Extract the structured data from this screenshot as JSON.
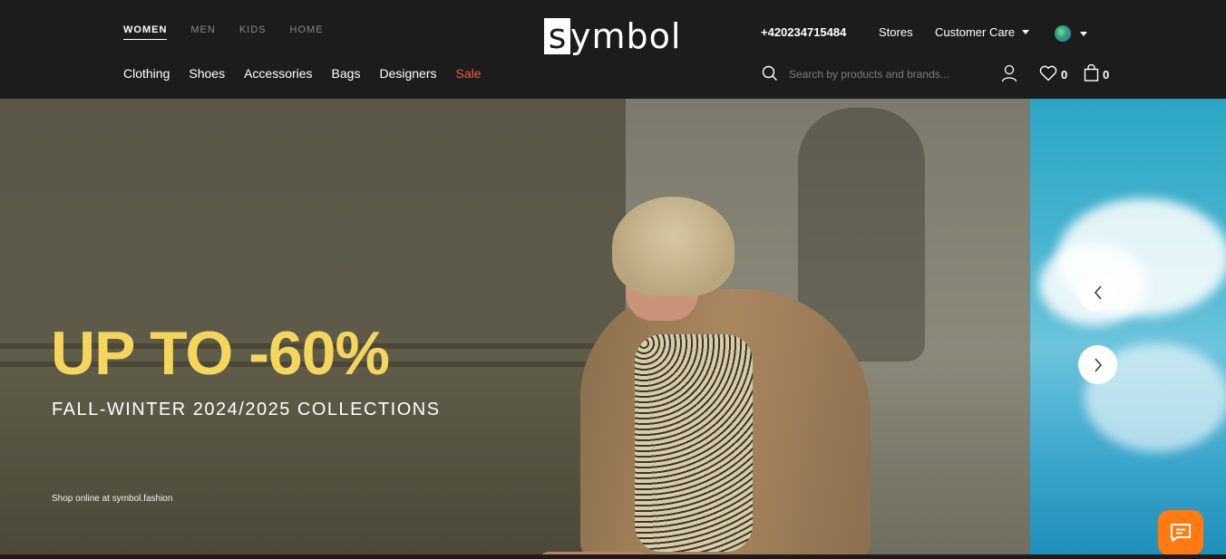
{
  "header": {
    "gender_tabs": [
      {
        "label": "WOMEN",
        "active": true
      },
      {
        "label": "MEN",
        "active": false
      },
      {
        "label": "KIDS",
        "active": false
      },
      {
        "label": "HOME",
        "active": false
      }
    ],
    "categories": [
      {
        "label": "Clothing"
      },
      {
        "label": "Shoes"
      },
      {
        "label": "Accessories"
      },
      {
        "label": "Bags"
      },
      {
        "label": "Designers"
      },
      {
        "label": "Sale"
      }
    ],
    "logo": {
      "box_letter": "s",
      "rest": "ymbol"
    },
    "phone": "+420234715484",
    "stores": "Stores",
    "customer_care": "Customer Care",
    "search_placeholder": "Search by products and brands...",
    "wishlist_count": "0",
    "bag_count": "0",
    "sale_color": "#ff5a36"
  },
  "hero": {
    "title": "UP TO -60%",
    "subtitle": "FALL-WINTER 2024/2025 COLLECTIONS",
    "note": "Shop online at symbol.fashion",
    "title_color": "#f5d65d"
  },
  "icons": {
    "search": "search-icon",
    "user": "user-icon",
    "wishlist": "heart-icon",
    "bag": "shopping-bag-icon",
    "globe": "globe-icon",
    "prev": "chevron-left-icon",
    "next": "chevron-right-icon",
    "chat": "chat-icon"
  },
  "chat_color": "#ff7a10"
}
